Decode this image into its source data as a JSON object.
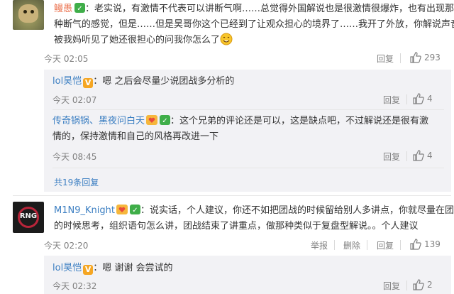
{
  "comments": [
    {
      "user": "鳗愚",
      "text_line1": "：老实说，有激情不代表可以讲断气啊……总觉得外国解说也是很激情很爆炸，也有出现那",
      "text_line2": "种断气的感觉，但是……但是昊哥你这个已经到了让观众担心的境界了……我开了外放，你解说声音",
      "text_line3": "被我妈听见了她还很担心的问我你怎么了",
      "time": "今天 02:05",
      "reply_label": "回复",
      "likes": "293",
      "replies": [
        {
          "user": "lol昊恺",
          "text": "：嗯 之后会尽量少说团战多分析的",
          "time": "今天 02:07",
          "reply_label": "回复",
          "likes": "4"
        },
        {
          "user": "传奇锅锅、黑夜问白天",
          "text_line1": "：这个兄弟的评论还是可以，这是缺点吧，不过解说还是很有激",
          "text_line2": "情的，保持激情和自己的风格再改进一下",
          "time": "今天 08:45",
          "reply_label": "回复",
          "likes": "4"
        }
      ],
      "more_replies": "共19条回复"
    },
    {
      "user": "M1N9_Knight",
      "text_line1": "：说实话，个人建议，你还不如把团战的时候留给别人多讲点，你就尽量在团",
      "text_line2": "的时候思考，组织语句怎么讲，团战结束了讲重点，做那种类似于复盘型解说。。个人建议",
      "time": "今天 02:20",
      "report_label": "举报",
      "delete_label": "删除",
      "reply_label": "回复",
      "likes": "139",
      "avatar_text": "RNG",
      "replies": [
        {
          "user": "lol昊恺",
          "text": "：嗯 谢谢 会尝试的",
          "time": "今天 02:32",
          "reply_label": "回复",
          "likes": "2"
        }
      ]
    }
  ]
}
